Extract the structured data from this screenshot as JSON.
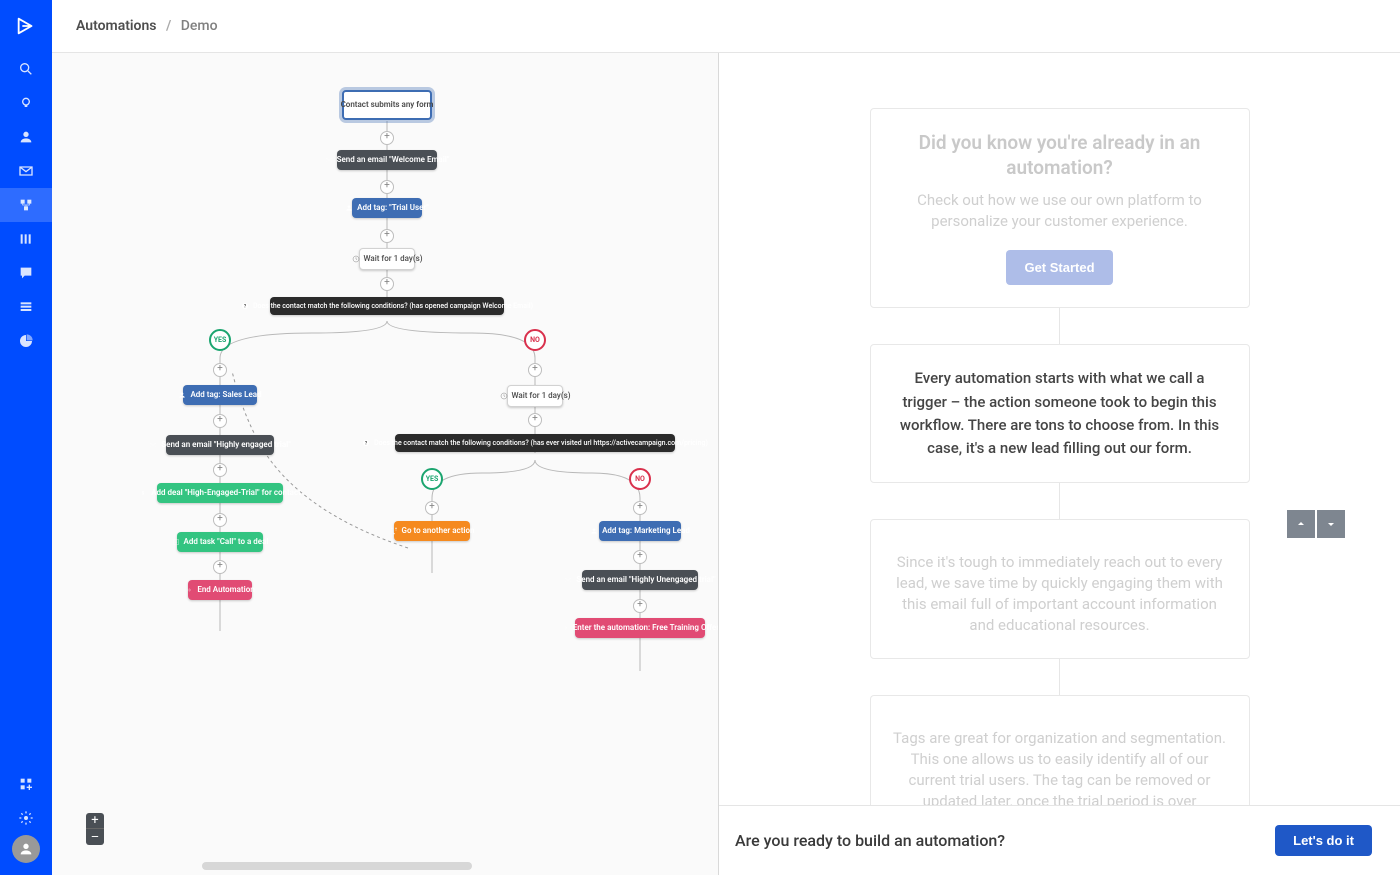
{
  "breadcrumb": {
    "root": "Automations",
    "current": "Demo"
  },
  "nodes": {
    "trigger": "Contact submits any form",
    "welcome_email": "Send an email \"Welcome Email\"",
    "tag_trial": "Add tag: \"Trial User\"",
    "wait1": "Wait for 1 day(s)",
    "cond1": "Does the contact match the following conditions? (has opened campaign Welcome Email)",
    "yes": "YES",
    "no": "NO",
    "tag_sales": "Add tag: Sales Lead",
    "email_engaged": "Send an email \"Highly engaged trial\"",
    "add_deal": "Add deal \"High-Engaged-Trial\" for contact",
    "add_task": "Add task \"Call\" to a deal",
    "end_auto": "End Automation",
    "wait2": "Wait for 1 day(s)",
    "cond2": "Does the contact match the following conditions? (has ever visited url https://activecampaign.com/pricing)",
    "goto": "Go to another action",
    "tag_marketing": "Add tag: Marketing Lead",
    "email_unengaged": "Send an email \"Highly Unengaged trial\"",
    "enter_auto": "Enter the automation: Free Training Offer"
  },
  "zoom": {
    "plus": "+",
    "minus": "–"
  },
  "panel": {
    "card1": {
      "title": "Did you know you're already in an automation?",
      "body": "Check out how we use our own platform to personalize your customer experience.",
      "cta": "Get Started"
    },
    "card2": {
      "body": "Every automation starts with what we call a trigger – the action someone took to begin this workflow. There are tons to choose from. In this case, it's a new lead filling out our form."
    },
    "card3": {
      "body": "Since it's tough to immediately reach out to every lead, we save time by quickly engaging them with this email full of important account information and educational resources."
    },
    "card4": {
      "body": "Tags are great for organization and segmentation. This one allows us to easily identify all of our current trial users. The tag can be removed or updated later, once the trial period is over (perhaps after they choose a paid plan and enter a new automation)."
    }
  },
  "footer": {
    "question": "Are you ready to build an automation?",
    "cta": "Let's do it"
  }
}
